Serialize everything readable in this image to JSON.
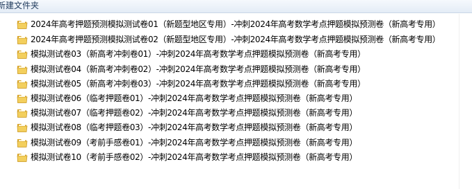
{
  "toolbar": {
    "new_folder_label": "新建文件夹"
  },
  "files": [
    {
      "name": "2024年高考押题预测模拟测试卷01（新题型地区专用）-冲刺2024年高考数学考点押题模拟预测卷（新高考专用）",
      "icon": "folder-icon"
    },
    {
      "name": "2024年高考押题预测模拟测试卷02（新题型地区专用）-冲刺2024年高考数学考点押题模拟预测卷（新高考专用）",
      "icon": "folder-icon"
    },
    {
      "name": "模拟测试卷03（新高考冲刺卷01）-冲刺2024年高考数学考点押题模拟预测卷（新高考专用）",
      "icon": "folder-icon"
    },
    {
      "name": "模拟测试卷04（新高考冲刺卷02）-冲刺2024年高考数学考点押题模拟预测卷（新高考专用）",
      "icon": "folder-icon"
    },
    {
      "name": "模拟测试卷05（新高考冲刺卷03）-冲刺2024年高考数学考点押题模拟预测卷（新高考专用）",
      "icon": "folder-icon"
    },
    {
      "name": "模拟测试卷06（临考押题卷01）-冲刺2024年高考数学考点押题模拟预测卷（新高考专用）",
      "icon": "folder-icon"
    },
    {
      "name": "模拟测试卷07（临考押题卷02）-冲刺2024年高考数学考点押题模拟预测卷（新高考专用）",
      "icon": "folder-icon"
    },
    {
      "name": "模拟测试卷08（临考押题卷03）-冲刺2024年高考数学考点押题模拟预测卷（新高考专用）",
      "icon": "folder-icon"
    },
    {
      "name": "模拟测试卷09（考前手感卷01）-冲刺2024年高考数学考点押题模拟预测卷（新高考专用）",
      "icon": "folder-icon"
    },
    {
      "name": "模拟测试卷10（考前手感卷02）-冲刺2024年高考数学考点押题模拟预测卷（新高考专用）",
      "icon": "folder-icon"
    }
  ]
}
